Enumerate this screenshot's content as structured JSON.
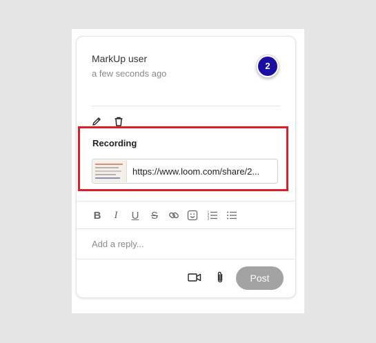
{
  "comment": {
    "author": "MarkUp user",
    "timestamp": "a few seconds ago",
    "pin_number": "2",
    "pin_color": "#1b0fa3"
  },
  "actions": {
    "edit_icon": "pencil-icon",
    "delete_icon": "trash-icon"
  },
  "recording": {
    "label": "Recording",
    "url_display": "https://www.loom.com/share/2...",
    "highlight_color": "#d9202a"
  },
  "formatting_toolbar": {
    "bold": "B",
    "italic": "I",
    "underline": "U",
    "strikethrough": "S",
    "icons": [
      "bold-icon",
      "italic-icon",
      "underline-icon",
      "strikethrough-icon",
      "link-icon",
      "emoji-icon",
      "numbered-list-icon",
      "bulleted-list-icon"
    ]
  },
  "reply": {
    "placeholder": "Add a reply...",
    "post_label": "Post",
    "video_icon": "video-camera-icon",
    "attach_icon": "paperclip-icon"
  }
}
